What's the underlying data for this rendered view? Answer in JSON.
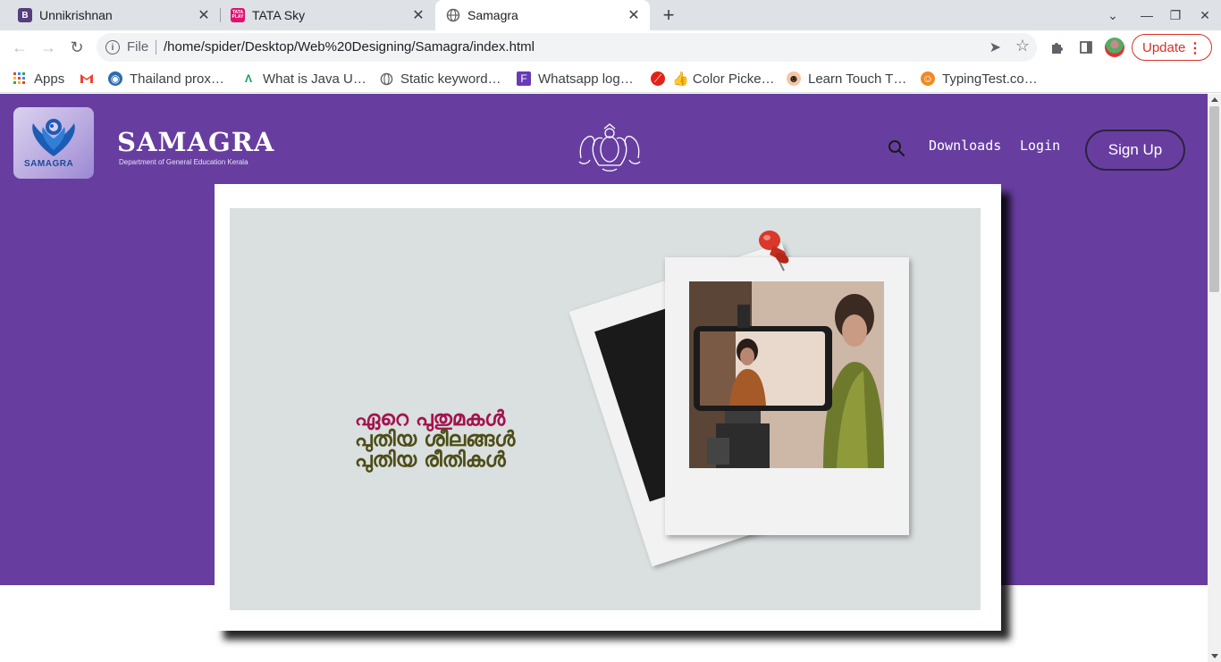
{
  "browser": {
    "tabs": [
      {
        "title": "Unnikrishnan",
        "favicon": "B",
        "favicon_color": "#563d7c",
        "close": "✕"
      },
      {
        "title": "TATA Sky",
        "favicon": "TATA PLAY",
        "favicon_color": "#e0116f",
        "close": "✕"
      },
      {
        "title": "Samagra",
        "favicon": "globe-icon",
        "close": "✕"
      }
    ],
    "new_tab": "+",
    "window_controls": [
      "⌄",
      "—",
      "❐",
      "✕"
    ],
    "omnibox": {
      "scheme_label": "File",
      "url": "/home/spider/Desktop/Web%20Designing/Samagra/index.html"
    },
    "update_label": "Update",
    "bookmarks": [
      {
        "label": "Apps",
        "icon": "apps-grid-icon"
      },
      {
        "label": "",
        "icon": "gmail-icon"
      },
      {
        "label": "Thailand prox…",
        "icon": "globe-icon"
      },
      {
        "label": "What is Java U…",
        "icon": "android-icon"
      },
      {
        "label": "Static keyword…",
        "icon": "globe-icon"
      },
      {
        "label": "Whatsapp log…",
        "icon": "form-icon"
      },
      {
        "label": "👍 Color Picke…",
        "icon": "colorpicker-icon"
      },
      {
        "label": "Learn Touch T…",
        "icon": "face-icon"
      },
      {
        "label": "TypingTest.co…",
        "icon": "typing-icon"
      }
    ]
  },
  "page": {
    "brand": {
      "name": "SAMAGRA",
      "subtitle": "Department of General Education Kerala",
      "logo_text": "SAMAGRA"
    },
    "nav": {
      "downloads": "Downloads",
      "login": "Login",
      "signup": "Sign Up"
    },
    "hero": {
      "line1": "ഏറെ പുതുമകൾ",
      "line2": "പുതിയ ശീലങ്ങൾ",
      "line3": "പുതിയ രീതികൾ"
    },
    "colors": {
      "header_bg": "#673ea0",
      "hero_red": "#a4134d",
      "hero_olive": "#4d4d16"
    }
  }
}
